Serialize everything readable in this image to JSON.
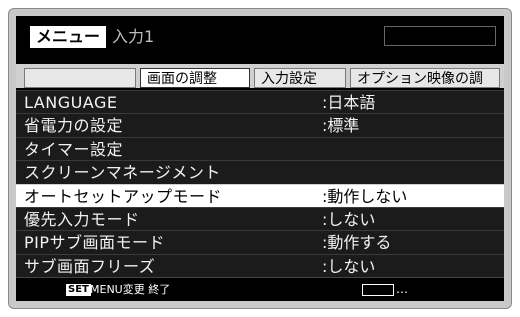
{
  "header": {
    "menu_label": "メニュー",
    "input_label": "入力1"
  },
  "tabs": [
    {
      "label": ""
    },
    {
      "label": "画面の調整"
    },
    {
      "label": "入力設定"
    },
    {
      "label": "オプション映像の調"
    }
  ],
  "menu": {
    "selected_index": 4,
    "items": [
      {
        "label": "LANGUAGE",
        "value": ":日本語"
      },
      {
        "label": "省電力の設定",
        "value": ":標準"
      },
      {
        "label": "タイマー設定",
        "value": ""
      },
      {
        "label": "スクリーンマネージメント",
        "value": ""
      },
      {
        "label": "オートセットアップモード",
        "value": ":動作しない"
      },
      {
        "label": "優先入力モード",
        "value": ":しない"
      },
      {
        "label": "PIPサブ画面モード",
        "value": ":動作する"
      },
      {
        "label": "サブ画面フリーズ",
        "value": ":しない"
      }
    ]
  },
  "footer": {
    "set_label": "SET",
    "text": "MENU変更  終了",
    "dots": "…"
  },
  "colors": {
    "screen_bg": "#000000",
    "row_bg": "#1b1b1b",
    "selected_bg": "#ffffff",
    "text": "#f2f2f2"
  }
}
